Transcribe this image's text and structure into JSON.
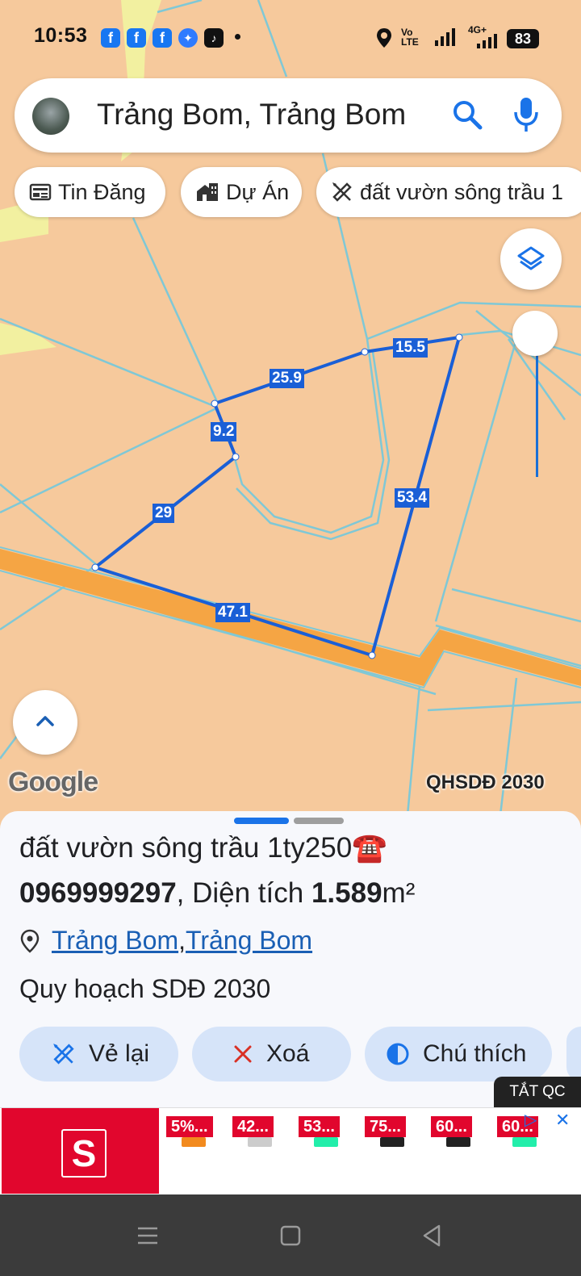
{
  "status_bar": {
    "time": "10:53",
    "network_volte": "Vo LTE",
    "network_4g": "4G+",
    "battery": "83"
  },
  "search": {
    "query": "Trảng Bom, Trảng Bom"
  },
  "chips": [
    {
      "label": "Tin Đăng",
      "icon": "newspaper-icon"
    },
    {
      "label": "Dự Án",
      "icon": "buildings-icon"
    },
    {
      "label": "đất vườn sông trầu 1",
      "icon": "ruler-pencil-icon"
    }
  ],
  "map": {
    "segment_labels": [
      "15.5",
      "25.9",
      "9.2",
      "29",
      "53.4",
      "47.1"
    ],
    "logo": "Google",
    "plan_label": "QHSDĐ 2030"
  },
  "sheet": {
    "title_line1": "đất vườn sông trầu 1ty250☎️",
    "phone": "0969999297",
    "area_prefix": ", Diện tích ",
    "area_value": "1.589",
    "area_unit": "m²",
    "location_district": "Trảng Bom",
    "location_sep": ", ",
    "location_town": "Trảng Bom",
    "plan": "Quy hoạch SDĐ 2030",
    "actions": [
      {
        "label": "Vẻ lại",
        "icon": "ruler-pencil-icon"
      },
      {
        "label": "Xoá",
        "icon": "close-icon"
      },
      {
        "label": "Chú thích",
        "icon": "contrast-icon"
      }
    ]
  },
  "ad": {
    "hide_ads": "TẮT QC",
    "logo_letter": "S",
    "tags": [
      "5%...",
      "42...",
      "53...",
      "75...",
      "60...",
      "60..."
    ],
    "colors": {
      "brand": "#e1062d"
    }
  },
  "colors": {
    "map_bg": "#f6c99c",
    "parcel_line": "#1a5fd6",
    "accent": "#1a73e8",
    "road": "#f5a544"
  }
}
